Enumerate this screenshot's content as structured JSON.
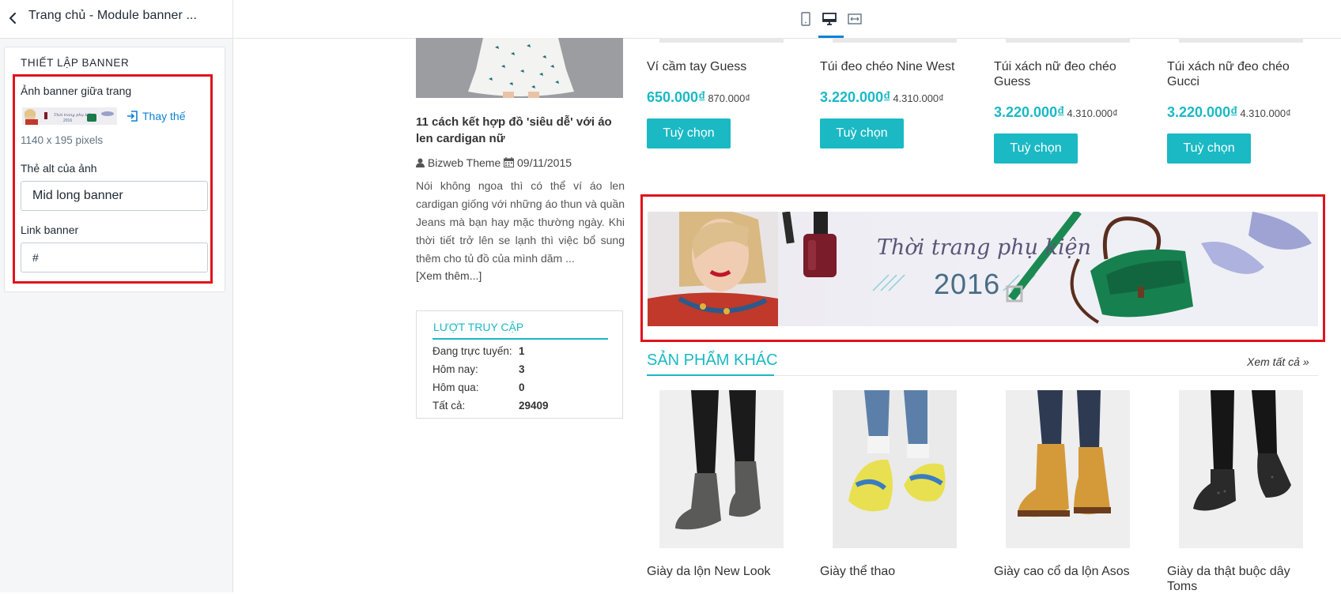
{
  "editor": {
    "title": "Trang chủ - Module banner ...",
    "card_title": "THIẾT LẬP BANNER",
    "image_label": "Ảnh banner giữa trang",
    "replace_label": "Thay thế",
    "dimensions": "1140 x 195 pixels",
    "alt_label": "Thẻ alt của ảnh",
    "alt_value": "Mid long banner",
    "link_label": "Link banner",
    "link_value": "#"
  },
  "toolbar": {
    "devices": [
      "mobile-icon",
      "desktop-icon",
      "fullwidth-icon"
    ],
    "active": "desktop"
  },
  "blog": {
    "title": "11 cách kết hợp đồ 'siêu dễ' với áo len cardigan nữ",
    "author": "Bizweb Theme",
    "date": "09/11/2015",
    "excerpt": "Nói không ngoa thì có thể ví áo len cardigan giống với những áo thun và quần Jeans mà bạn hay mặc thường ngày. Khi thời tiết trở lên se lạnh thì việc bổ sung thêm cho tủ đồ của mình dăm ...",
    "more": "[Xem thêm...]"
  },
  "visits": {
    "title": "LƯỢT TRUY CẬP",
    "rows": [
      {
        "label": "Đang trực tuyến:",
        "value": "1"
      },
      {
        "label": "Hôm nay:",
        "value": "3"
      },
      {
        "label": "Hôm qua:",
        "value": "0"
      },
      {
        "label": "Tất cả:",
        "value": "29409"
      }
    ]
  },
  "products": [
    {
      "name": "Ví cầm tay Guess",
      "price": "650.000₫",
      "old_price": "870.000₫",
      "button": "Tuỳ chọn"
    },
    {
      "name": "Túi đeo chéo Nine West",
      "price": "3.220.000₫",
      "old_price": "4.310.000₫",
      "button": "Tuỳ chọn"
    },
    {
      "name": "Túi xách nữ đeo chéo Guess",
      "price": "3.220.000₫",
      "old_price": "4.310.000₫",
      "button": "Tuỳ chọn"
    },
    {
      "name": "Túi xách nữ đeo chéo Gucci",
      "price": "3.220.000₫",
      "old_price": "4.310.000₫",
      "button": "Tuỳ chọn"
    }
  ],
  "banner": {
    "title": "Thời trang phụ kiện",
    "year": "2016"
  },
  "other_products": {
    "title": "SẢN PHẨM KHÁC",
    "view_all": "Xem tất cả",
    "items": [
      {
        "name": "Giày da lộn New Look"
      },
      {
        "name": "Giày thể thao"
      },
      {
        "name": "Giày cao cổ da lộn Asos"
      },
      {
        "name": "Giày da thật buộc dây Toms"
      }
    ]
  },
  "colors": {
    "accent": "#1ab9c4",
    "highlight": "#e0131c",
    "link": "#0b82d5"
  }
}
